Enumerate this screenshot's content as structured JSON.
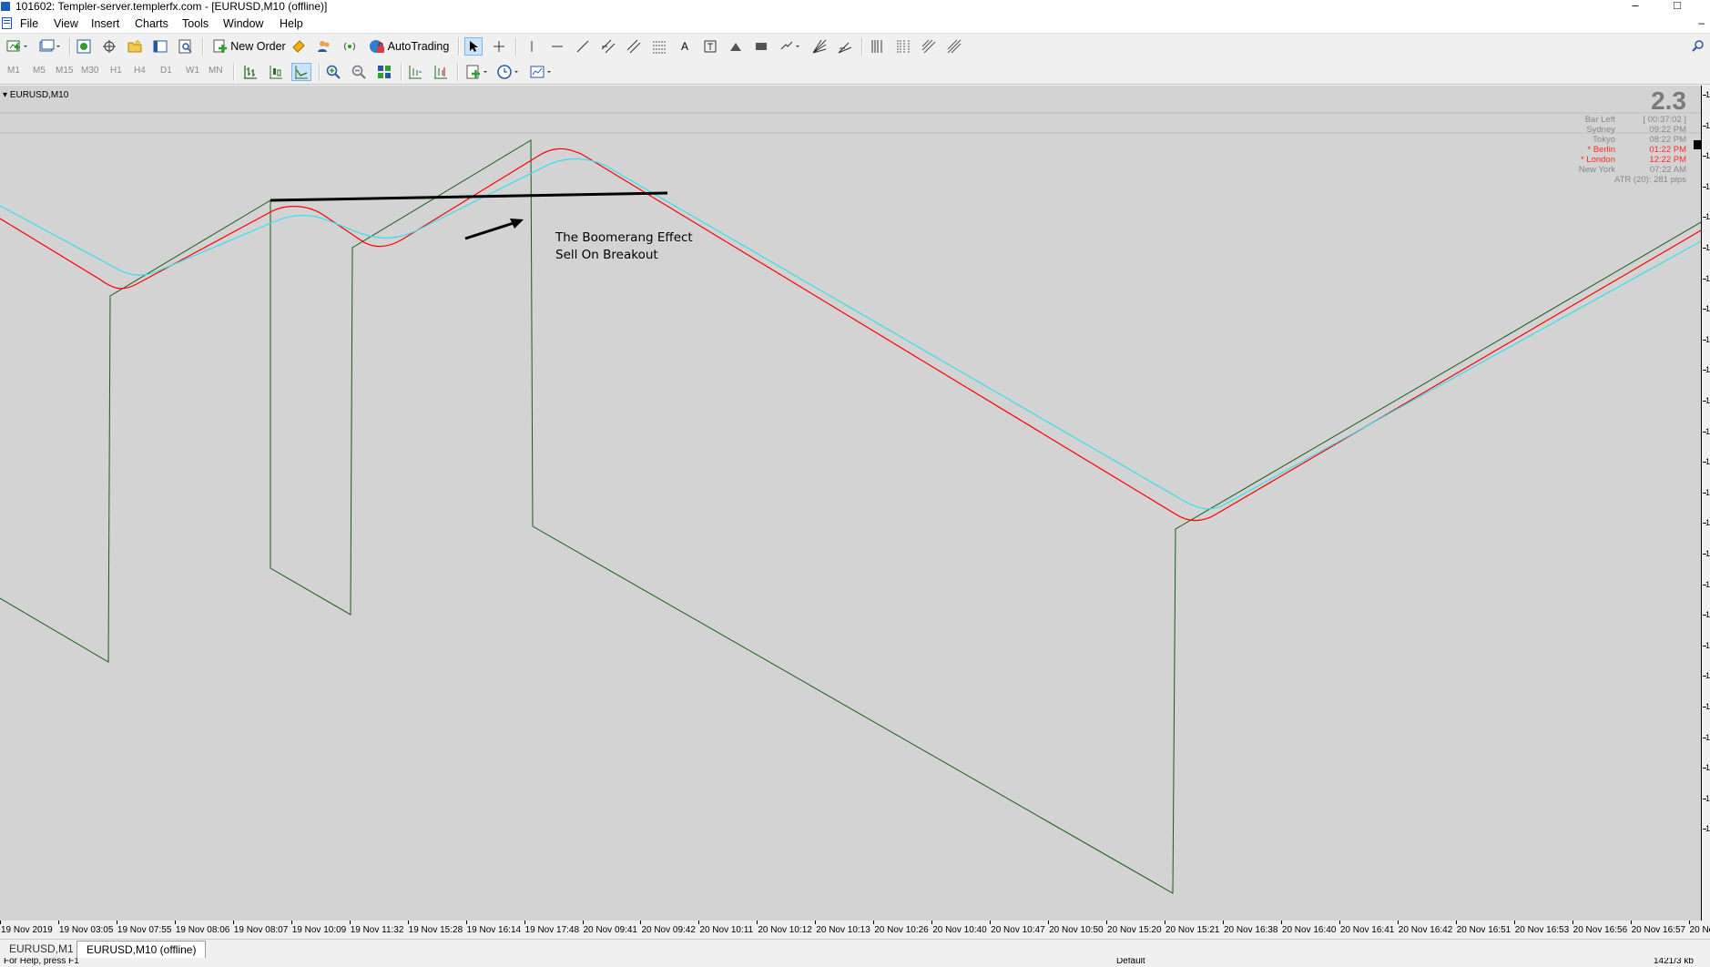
{
  "window": {
    "title": "101602: Templer-server.templerfx.com - [EURUSD,M10 (offline)]",
    "minimize": "–",
    "maximize": "□",
    "mdi_minimize": "–"
  },
  "menu": [
    "File",
    "View",
    "Insert",
    "Charts",
    "Tools",
    "Window",
    "Help"
  ],
  "toolbar": {
    "new_order_label": "New Order",
    "autotrading_label": "AutoTrading",
    "text_tool_label": "A"
  },
  "timeframes": [
    "M1",
    "M5",
    "M15",
    "M30",
    "H1",
    "H4",
    "D1",
    "W1",
    "MN"
  ],
  "chart": {
    "symbol_label": "EURUSD,M10",
    "price_label_char": "1",
    "price_ticks_count": 25,
    "annotation_line1": "The Boomerang Effect",
    "annotation_line2": "Sell On Breakout",
    "background": "#d3d3d3",
    "colors": {
      "price_line": "#1a5c1a",
      "red_ma": "#ff0000",
      "cyan_ma": "#33e0ee",
      "trendline": "#000000"
    },
    "time_labels": [
      "19 Nov 2019",
      "19 Nov 03:05",
      "19 Nov 07:55",
      "19 Nov 08:06",
      "19 Nov 08:07",
      "19 Nov 10:09",
      "19 Nov 11:32",
      "19 Nov 15:28",
      "19 Nov 16:14",
      "19 Nov 17:48",
      "20 Nov 09:41",
      "20 Nov 09:42",
      "20 Nov 10:11",
      "20 Nov 10:12",
      "20 Nov 10:13",
      "20 Nov 10:26",
      "20 Nov 10:40",
      "20 Nov 10:47",
      "20 Nov 10:50",
      "20 Nov 15:20",
      "20 Nov 15:21",
      "20 Nov 16:38",
      "20 Nov 16:40",
      "20 Nov 16:41",
      "20 Nov 16:42",
      "20 Nov 16:51",
      "20 Nov 16:53",
      "20 Nov 16:56",
      "20 Nov 16:57",
      "20 No"
    ]
  },
  "info_panel": {
    "big_value": "2.3",
    "rows": [
      {
        "label": "Bar Left",
        "value": "[ 00:37:02 ]",
        "highlight": false
      },
      {
        "label": "Sydney",
        "value": "09:22 PM",
        "highlight": false
      },
      {
        "label": "Tokyo",
        "value": "08:22 PM",
        "highlight": false
      },
      {
        "label": "* Berlin",
        "value": "01:22 PM",
        "highlight": true
      },
      {
        "label": "* London",
        "value": "12:22 PM",
        "highlight": true
      },
      {
        "label": "New York",
        "value": "07:22 AM",
        "highlight": false
      }
    ],
    "atr": "ATR (20): 281 pips"
  },
  "tabs": [
    {
      "label": "EURUSD,M1",
      "active": false
    },
    {
      "label": "EURUSD,M10 (offline)",
      "active": true
    }
  ],
  "status": {
    "left": "For Help, press F1",
    "profile": "Default",
    "bytes": "1421/3 kb"
  }
}
